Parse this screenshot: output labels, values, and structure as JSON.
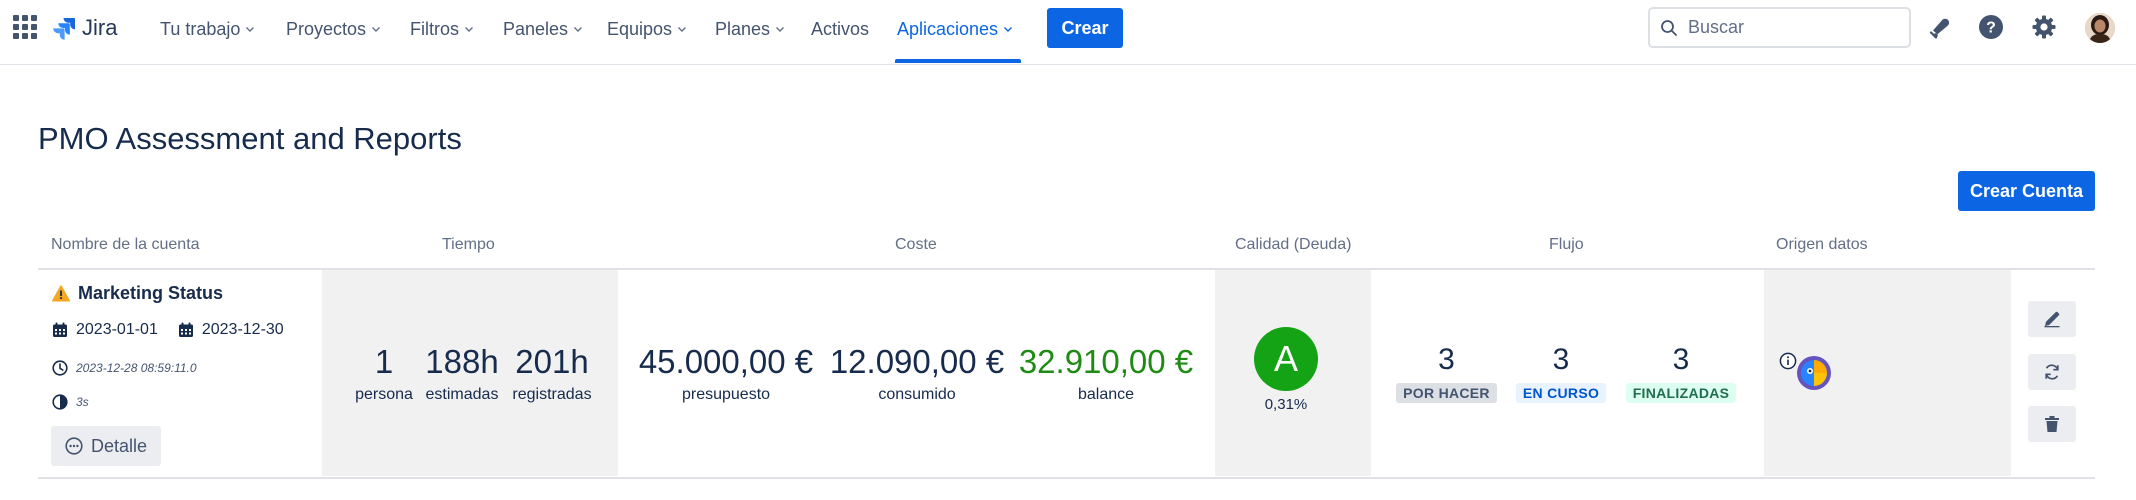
{
  "topnav": {
    "product": "Jira",
    "items": [
      {
        "label": "Tu trabajo",
        "dropdown": true
      },
      {
        "label": "Proyectos",
        "dropdown": true
      },
      {
        "label": "Filtros",
        "dropdown": true
      },
      {
        "label": "Paneles",
        "dropdown": true
      },
      {
        "label": "Equipos",
        "dropdown": true
      },
      {
        "label": "Planes",
        "dropdown": true
      },
      {
        "label": "Activos",
        "dropdown": false
      },
      {
        "label": "Aplicaciones",
        "dropdown": true,
        "active": true
      }
    ],
    "create_label": "Crear",
    "search_placeholder": "Buscar",
    "icons": [
      "app-switcher-icon",
      "notifications-icon",
      "help-icon",
      "settings-icon",
      "avatar"
    ]
  },
  "page": {
    "title": "PMO Assessment and Reports",
    "create_account_label": "Crear Cuenta"
  },
  "table": {
    "headers": {
      "account": "Nombre de la cuenta",
      "time": "Tiempo",
      "cost": "Coste",
      "quality": "Calidad (Deuda)",
      "flow": "Flujo",
      "source": "Origen datos"
    },
    "row": {
      "name": "Marketing Status",
      "start_date": "2023-01-01",
      "end_date": "2023-12-30",
      "updated": "2023-12-28 08:59:11.0",
      "duration": "3s",
      "detail_label": "Detalle",
      "time": [
        {
          "value": "1",
          "label": "persona"
        },
        {
          "value": "188h",
          "label": "estimadas"
        },
        {
          "value": "201h",
          "label": "registradas"
        }
      ],
      "cost": [
        {
          "value": "45.000,00 €",
          "label": "presupuesto"
        },
        {
          "value": "12.090,00 €",
          "label": "consumido"
        },
        {
          "value": "32.910,00 €",
          "label": "balance"
        }
      ],
      "quality": {
        "grade": "A",
        "debt": "0,31%"
      },
      "flow": [
        {
          "value": "3",
          "label": "POR HACER"
        },
        {
          "value": "3",
          "label": "EN CURSO"
        },
        {
          "value": "3",
          "label": "FINALIZADAS"
        }
      ]
    }
  },
  "colors": {
    "brand": "#0c66e4",
    "balance_positive": "#1f8b14",
    "grade_a": "#14a314",
    "warning": "#f5a623"
  }
}
